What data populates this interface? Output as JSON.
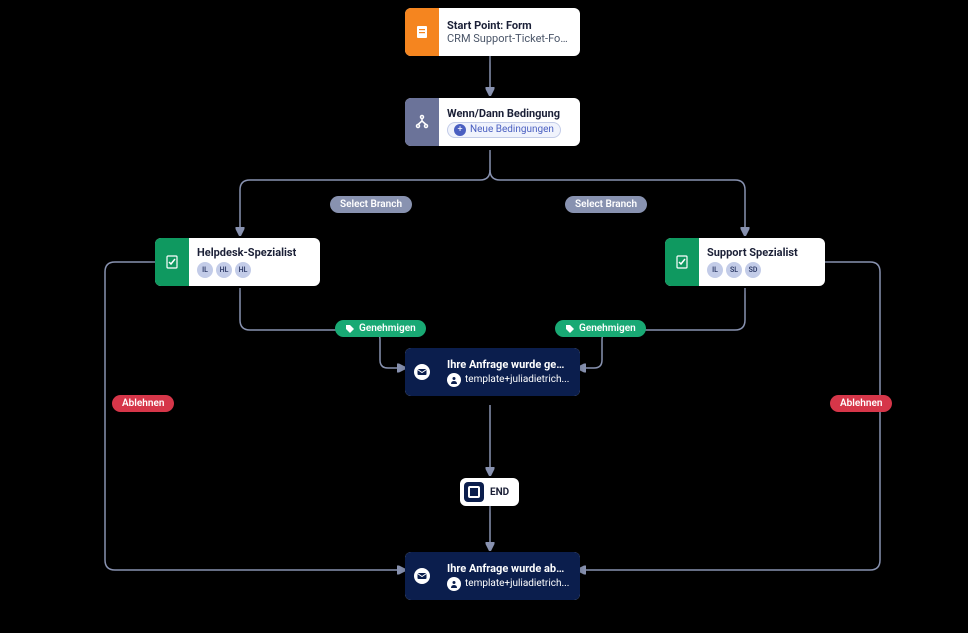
{
  "nodes": {
    "start": {
      "title": "Start Point: Form",
      "subtitle": "CRM Support-Ticket-For...",
      "accent": "#f5851f"
    },
    "condition": {
      "title": "Wenn/Dann Bedingung",
      "link_text": "Neue Bedingungen",
      "accent": "#6b7399"
    },
    "helpdesk": {
      "title": "Helpdesk-Spezialist",
      "avatars": [
        "IL",
        "HL",
        "HL"
      ],
      "accent": "#0f9960"
    },
    "support": {
      "title": "Support Spezialist",
      "avatars": [
        "IL",
        "SL",
        "SD"
      ],
      "accent": "#0f9960"
    },
    "approved": {
      "title": "Ihre Anfrage wurde genehmi...",
      "user": "template+juliadietrich...",
      "accent": "#0b1e4d"
    },
    "rejected": {
      "title": "Ihre Anfrage wurde abgelehnt.",
      "user": "template+juliadietrich...",
      "accent": "#0b1e4d"
    },
    "end": {
      "label": "END"
    }
  },
  "labels": {
    "select_branch": "Select Branch",
    "approve": "Genehmigen",
    "reject": "Ablehnen"
  }
}
